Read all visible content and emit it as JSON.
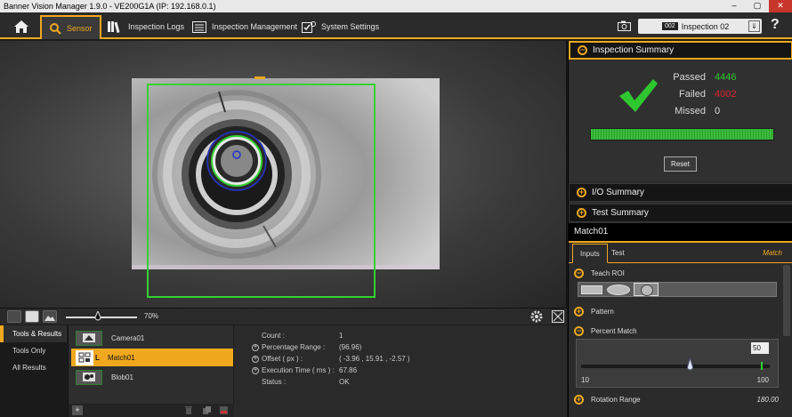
{
  "window": {
    "title": "Banner Vision Manager 1.9.0 - VE200G1A (IP: 192.168.0.1)"
  },
  "nav": {
    "tabs": [
      {
        "label": "Sensor",
        "icon": "search-gear-icon",
        "active": true
      },
      {
        "label": "Inspection Logs",
        "icon": "books-icon"
      },
      {
        "label": "Inspection Management",
        "icon": "list-icon"
      },
      {
        "label": "System Settings",
        "icon": "settings-check-icon"
      }
    ],
    "inspection": {
      "slot": "002",
      "name": "Inspection 02"
    },
    "help": "?"
  },
  "viewport": {
    "zoom": "70%",
    "roi_color": "#33d233"
  },
  "left_menu": [
    "Tools & Results",
    "Tools Only",
    "All Results"
  ],
  "tools": [
    {
      "name": "Camera01"
    },
    {
      "name": "Match01",
      "badge": "L"
    },
    {
      "name": "Blob01"
    }
  ],
  "results": [
    {
      "label": "Count :",
      "value": "1"
    },
    {
      "label": "Percentage Range :",
      "value": "(96.96)"
    },
    {
      "label": "Offset ( px ) :",
      "value": "( -3.96 , 15.91 , -2.57 )"
    },
    {
      "label": "Execution Time ( ms ) :",
      "value": "67.86"
    },
    {
      "label": "Status :",
      "value": "OK"
    }
  ],
  "summary": {
    "title": "Inspection Summary",
    "passed_label": "Passed",
    "passed": "4446",
    "failed_label": "Failed",
    "failed": "4002",
    "missed_label": "Missed",
    "missed": "0",
    "reset": "Reset",
    "colors": {
      "passed": "#2fc72f",
      "failed": "#d9262d"
    }
  },
  "sections": {
    "io": "I/O Summary",
    "test": "Test Summary"
  },
  "tool_panel": {
    "title": "Match01",
    "tab_inputs": "Inputs",
    "tab_test": "Test",
    "tool_type": "Match",
    "teach_roi": "Teach ROI",
    "pattern": "Pattern",
    "percent_match": "Percent Match",
    "percent_value": "50",
    "percent_level": 0.5,
    "slider_min": "10",
    "slider_max": "100",
    "rotation_label": "Rotation Range",
    "rotation_value": "180.00"
  }
}
